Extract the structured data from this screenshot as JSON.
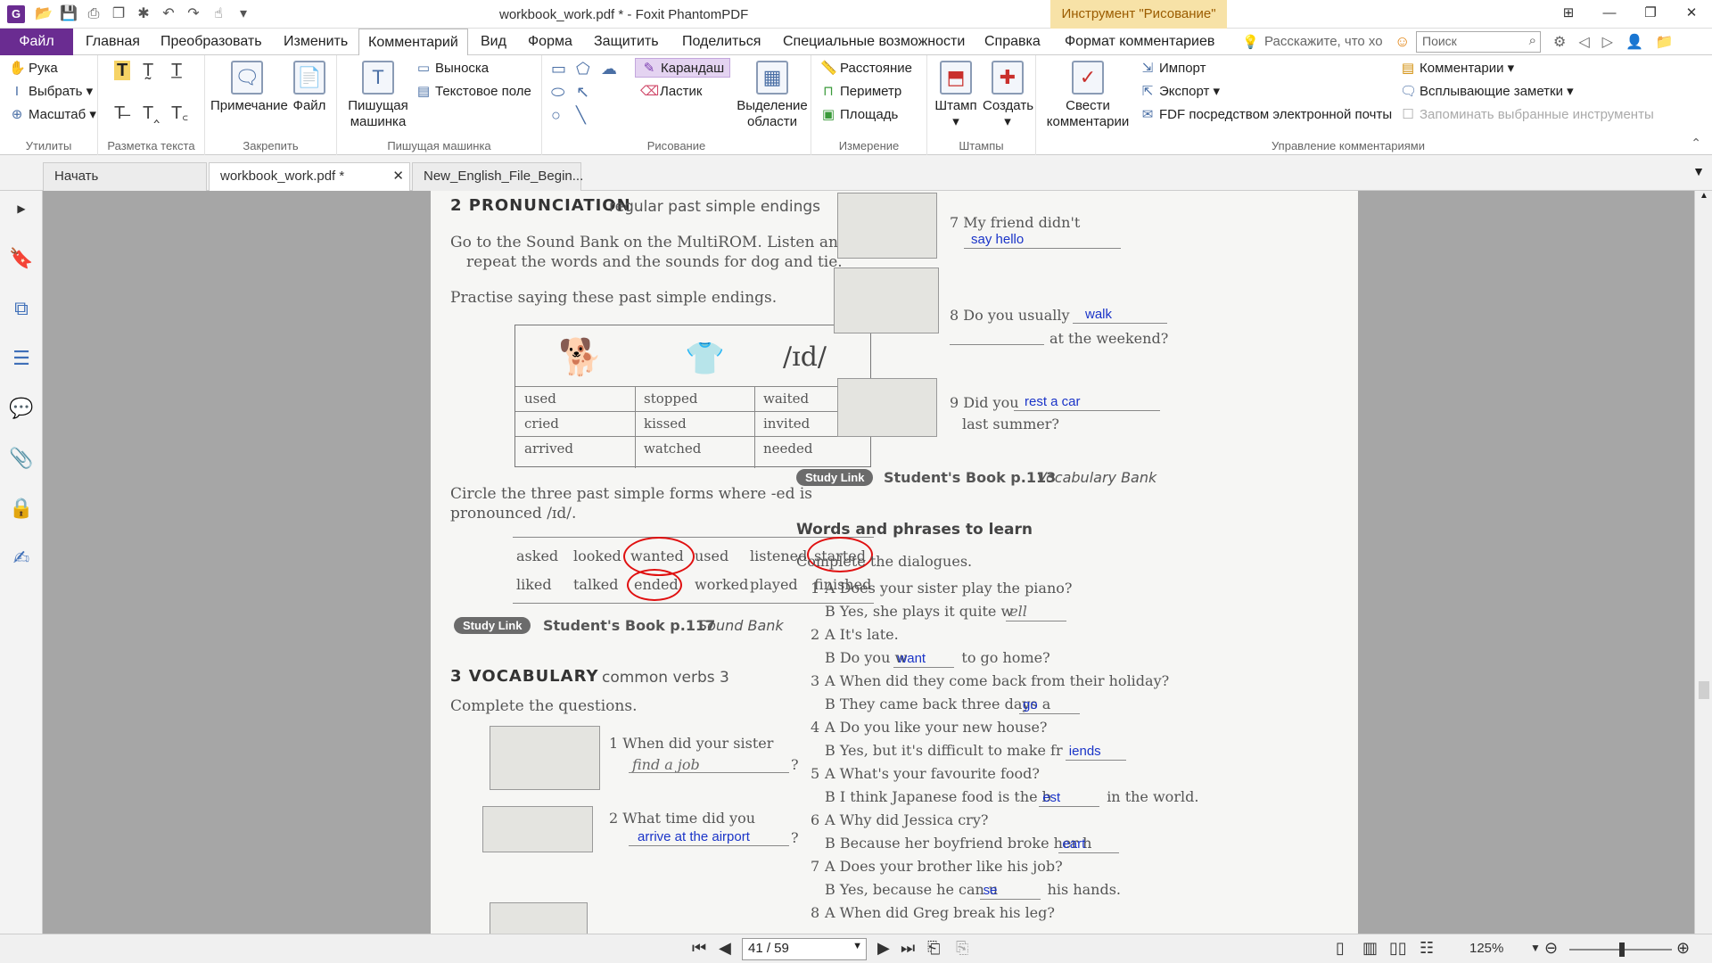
{
  "window": {
    "title": "workbook_work.pdf * - Foxit PhantomPDF",
    "context_tool": "Инструмент \"Рисование\""
  },
  "menu": {
    "items": [
      "Файл",
      "Главная",
      "Преобразовать",
      "Изменить",
      "Комментарий",
      "Вид",
      "Форма",
      "Защитить",
      "Поделиться",
      "Специальные возможности",
      "Справка",
      "Формат комментариев"
    ],
    "active": "Комментарий",
    "tell_me": "Расскажите, что хо",
    "search_placeholder": "Поиск"
  },
  "ribbon": {
    "utilities": {
      "label": "Утилиты",
      "items": [
        "Рука",
        "Выбрать",
        "Масштаб"
      ]
    },
    "text_markup": {
      "label": "Разметка текста"
    },
    "pin": {
      "label": "Закрепить",
      "note": "Примечание",
      "file": "Файл"
    },
    "typewriter": {
      "label": "Пишущая машинка",
      "big": "Пишущая машинка",
      "callout": "Выноска",
      "textbox": "Текстовое поле"
    },
    "drawing": {
      "label": "Рисование",
      "pencil": "Карандаш",
      "eraser": "Ластик",
      "area_highlight": "Выделение области"
    },
    "measure": {
      "label": "Измерение",
      "distance": "Расстояние",
      "perimeter": "Периметр",
      "area": "Площадь"
    },
    "stamps": {
      "label": "Штампы",
      "stamp": "Штамп",
      "create": "Создать"
    },
    "manage": {
      "label": "Управление комментариями",
      "summarize": "Свести комментарии",
      "import": "Импорт",
      "export": "Экспорт",
      "fdf": "FDF посредством электронной почты",
      "comments": "Комментарии",
      "popup": "Всплывающие заметки",
      "remember": "Запоминать выбранные инструменты"
    }
  },
  "tabs": [
    {
      "label": "Начать"
    },
    {
      "label": "workbook_work.pdf *"
    },
    {
      "label": "New_English_File_Begin..."
    }
  ],
  "status": {
    "page": "41 / 59",
    "zoom": "125%"
  },
  "doc": {
    "pron_heading": "2 PRONUNCIATION",
    "pron_sub": "regular past simple endings",
    "a_line1": "Go to the Sound Bank on the MultiROM. Listen and",
    "a_line2": "repeat the words and the sounds for dog and tie.",
    "b_line": "Practise saying these past simple endings.",
    "table_head3": "/ɪd/",
    "table_rows": [
      [
        "used",
        "stopped",
        "waited"
      ],
      [
        "cried",
        "kissed",
        "invited"
      ],
      [
        "arrived",
        "watched",
        "needed"
      ]
    ],
    "c_line1": "Circle the three past simple forms where -ed is",
    "c_line2": "pronounced /ɪd/.",
    "c_row1": [
      "asked",
      "looked",
      "wanted",
      "used",
      "listened",
      "started"
    ],
    "c_row2": [
      "liked",
      "talked",
      "ended",
      "worked",
      "played",
      "finished"
    ],
    "studylink": "Study Link",
    "sb1": "Student's Book p.117",
    "sb1_it": "Sound Bank",
    "vocab_heading": "3 VOCABULARY",
    "vocab_sub": "common verbs 3",
    "vocab_instr": "Complete the questions.",
    "q1": "1  When did your sister",
    "q1_ans": "find a job",
    "q2": "2  What time did you",
    "q2_ans": "arrive at the airport",
    "q7": "7  My friend didn't",
    "q7_ans": "say hello",
    "q8": "8  Do you usually",
    "q8_ans": "walk",
    "q8b": "at the weekend?",
    "q9": "9  Did you",
    "q9_ans": "rest a car",
    "q9b": "last summer?",
    "sb2": "Student's Book p.113",
    "sb2_it": "Vocabulary Bank",
    "words_heading": "Words and phrases to learn",
    "complete": "Complete the dialogues.",
    "dialogues": [
      {
        "n": "1",
        "a": "A  Does your sister play the piano?",
        "b": "B  Yes, she plays it quite w",
        "ans": "ell"
      },
      {
        "n": "2",
        "a": "A  It's late.",
        "b": "B  Do you w",
        "ans": "want",
        "tail": "to go home?"
      },
      {
        "n": "3",
        "a": "A  When did they come back from their holiday?",
        "b": "B  They came back three days a",
        "ans": "go"
      },
      {
        "n": "4",
        "a": "A  Do you like your new house?",
        "b": "B  Yes, but it's difficult to make fr",
        "ans": "iends"
      },
      {
        "n": "5",
        "a": "A  What's your favourite food?",
        "b": "B  I think Japanese food is the b",
        "ans": "est",
        "tail": "in the world."
      },
      {
        "n": "6",
        "a": "A  Why did Jessica cry?",
        "b": "B  Because her boyfriend broke her h",
        "ans": "eart"
      },
      {
        "n": "7",
        "a": "A  Does your brother like his job?",
        "b": "B  Yes, because he can u",
        "ans": "se",
        "tail": "his hands."
      },
      {
        "n": "8",
        "a": "A  When did Greg break his leg?",
        "b": "",
        "ans": ""
      }
    ]
  }
}
